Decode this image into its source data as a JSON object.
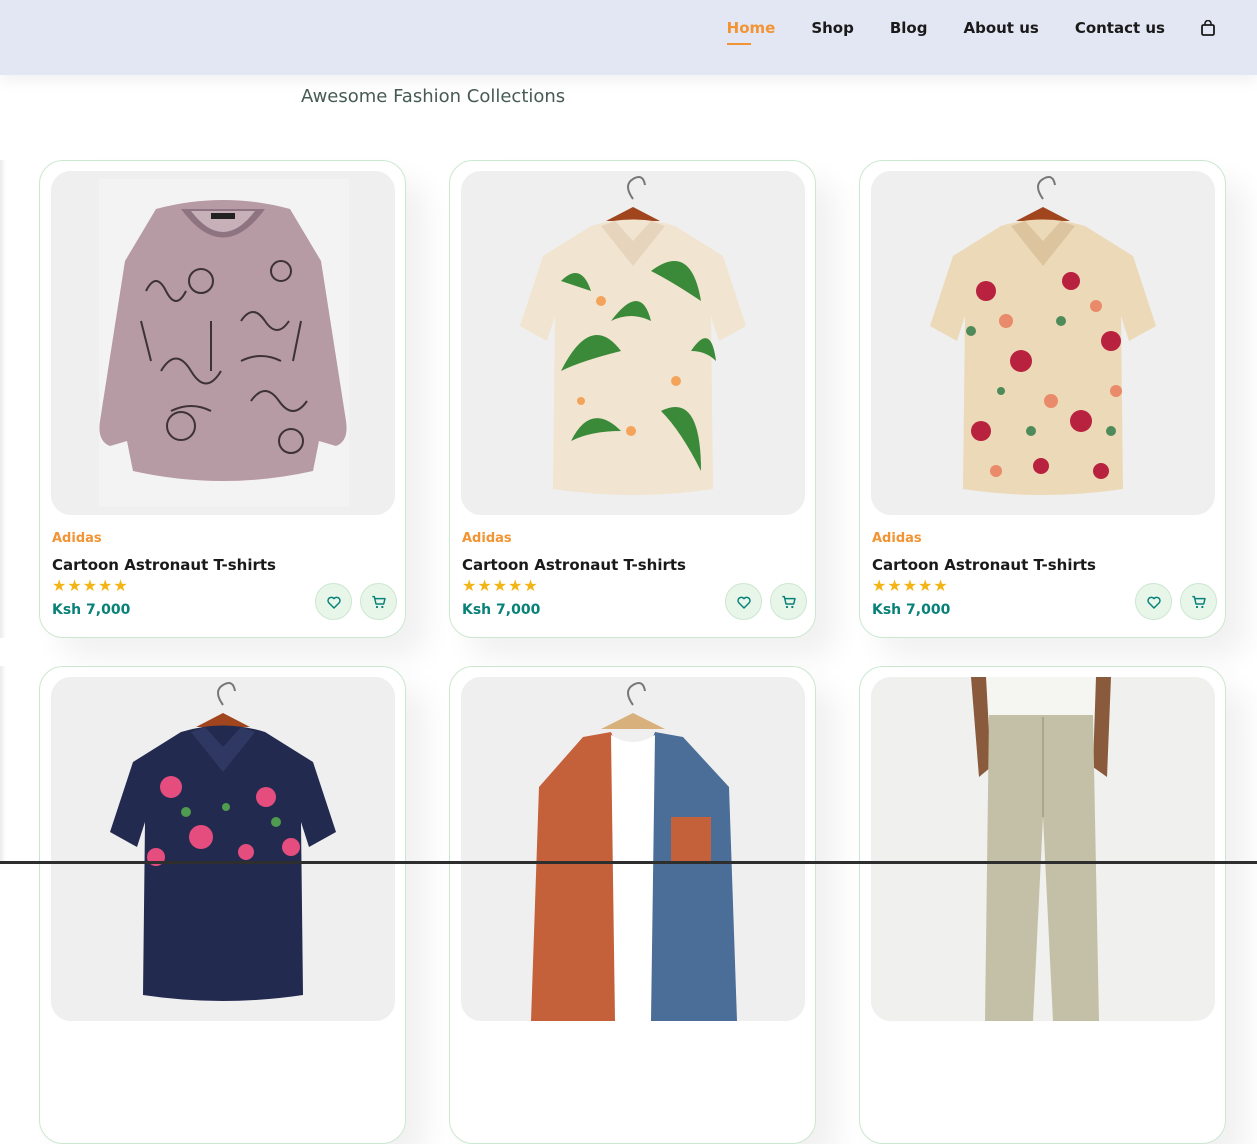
{
  "nav": {
    "items": [
      "Home",
      "Shop",
      "Blog",
      "About us",
      "Contact us"
    ],
    "active": "Home",
    "bag_icon": "shopping-bag-icon"
  },
  "section": {
    "subtitle": "Awesome Fashion Collections"
  },
  "colors": {
    "accent": "#f29433",
    "price": "#088178",
    "star": "#f3b516",
    "nav_bg": "#e3e6f3"
  },
  "products": [
    {
      "brand": "Adidas",
      "name": "Cartoon Astronaut T-shirts",
      "rating": 5,
      "stars": "★★★★★",
      "price": "Ksh 7,000",
      "image": "lilac-cat-print-blouse"
    },
    {
      "brand": "Adidas",
      "name": "Cartoon Astronaut T-shirts",
      "rating": 5,
      "stars": "★★★★★",
      "price": "Ksh 7,000",
      "image": "tropical-leaf-shirt-on-hanger"
    },
    {
      "brand": "Adidas",
      "name": "Cartoon Astronaut T-shirts",
      "rating": 5,
      "stars": "★★★★★",
      "price": "Ksh 7,000",
      "image": "floral-rose-shirt-on-hanger"
    },
    {
      "image": "navy-floral-shirt-on-hanger"
    },
    {
      "image": "orange-blue-corduroy-jacket"
    },
    {
      "image": "linen-trousers-model"
    }
  ]
}
